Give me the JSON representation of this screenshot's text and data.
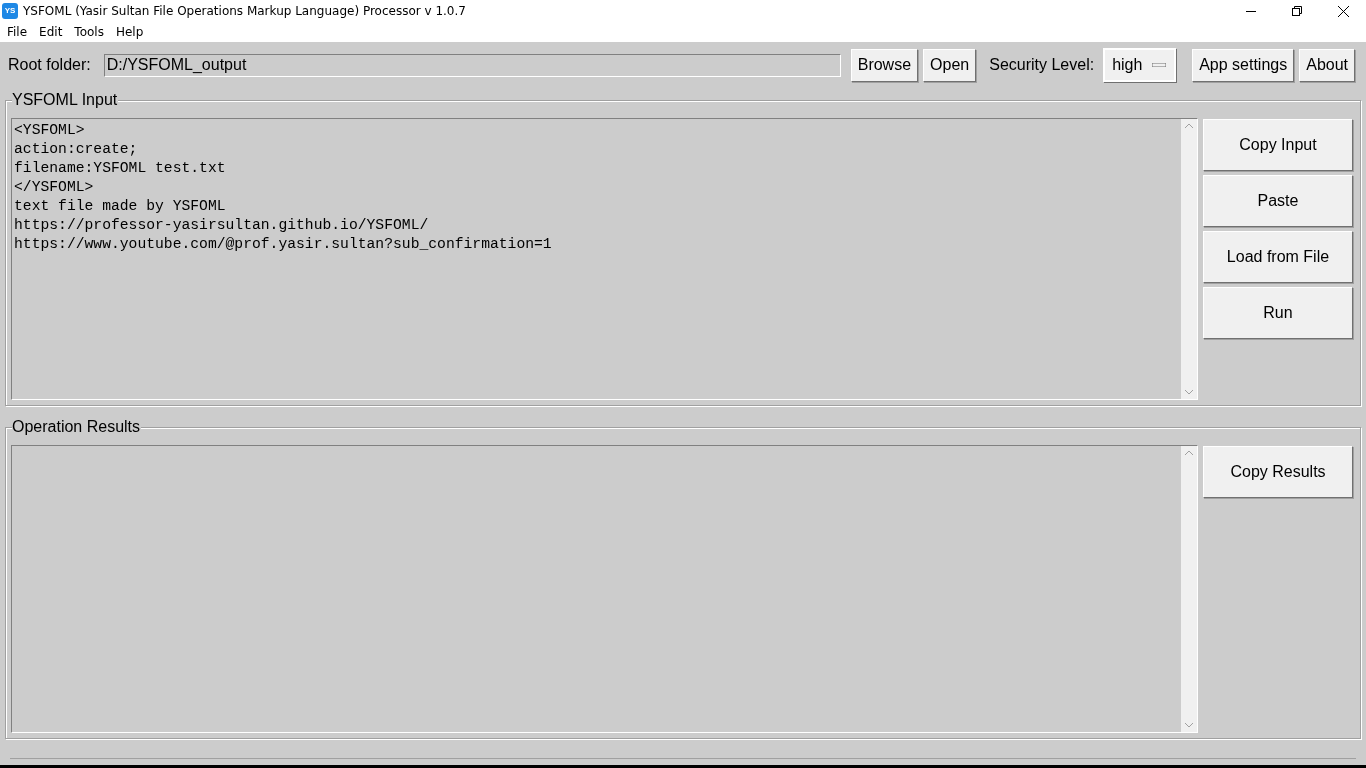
{
  "window": {
    "title": "YSFOML (Yasir Sultan File Operations Markup Language) Processor v 1.0.7",
    "app_icon": "YS"
  },
  "menu": [
    "File",
    "Edit",
    "Tools",
    "Help"
  ],
  "toolbar": {
    "root_label": "Root folder:",
    "root_value": "D:/YSFOML_output",
    "browse": "Browse",
    "open": "Open",
    "security_label": "Security Level:",
    "security_value": "high",
    "app_settings": "App settings",
    "about": "About"
  },
  "input_panel": {
    "title": "YSFOML Input",
    "lines": [
      "<YSFOML>",
      "action:create;",
      "filename:YSFOML test.txt",
      "</YSFOML>",
      "text file made by YSFOML",
      "https://professor-yasirsultan.github.io/YSFOML/",
      "https://www.youtube.com/@prof.yasir.sultan?sub_confirmation=1"
    ],
    "buttons": [
      "Copy Input",
      "Paste",
      "Load from File",
      "Run"
    ]
  },
  "results_panel": {
    "title": "Operation Results",
    "buttons": [
      "Copy Results"
    ]
  }
}
